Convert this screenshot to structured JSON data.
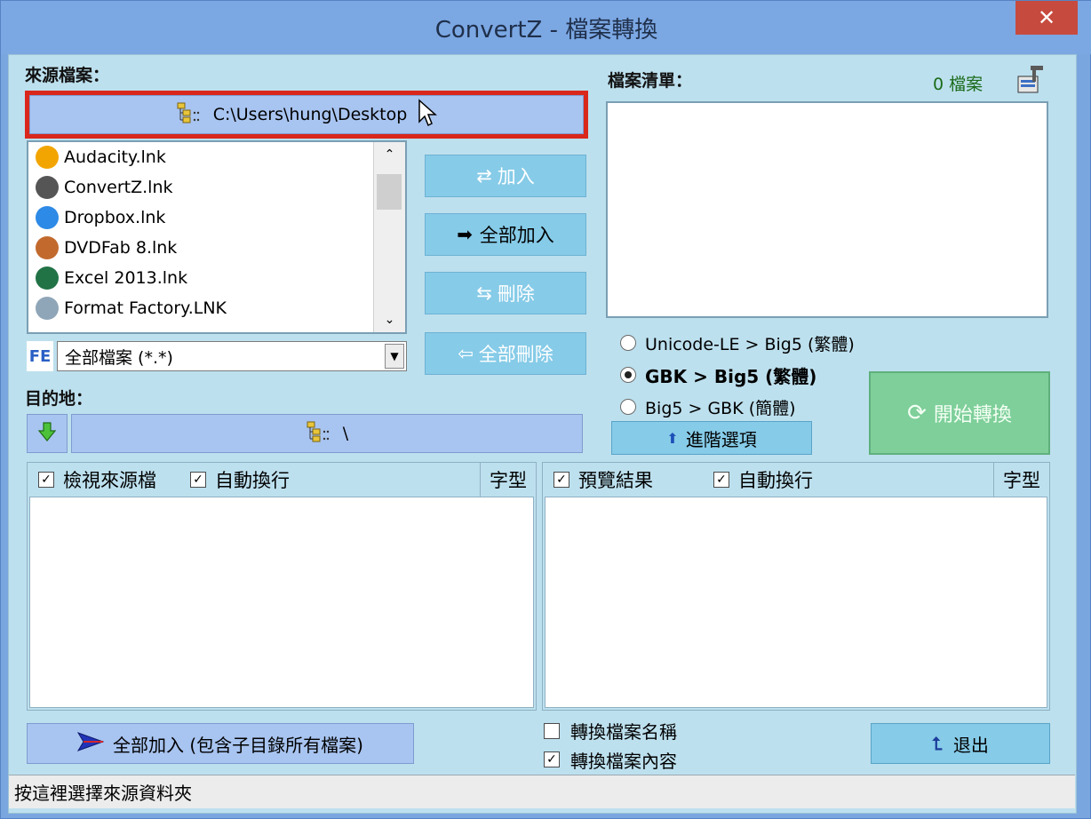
{
  "window": {
    "title": "ConvertZ - 檔案轉換",
    "close_label": "✕"
  },
  "source": {
    "label": "來源檔案：",
    "path": "C:\\Users\\hung\\Desktop",
    "files": [
      {
        "name": "Audacity.lnk",
        "icon": "audacity-icon",
        "color": "#f2a500"
      },
      {
        "name": "ConvertZ.lnk",
        "icon": "gear-icon",
        "color": "#555555"
      },
      {
        "name": "Dropbox.lnk",
        "icon": "dropbox-icon",
        "color": "#2d8ae6"
      },
      {
        "name": "DVDFab 8.lnk",
        "icon": "dvdfab-icon",
        "color": "#c26a2e"
      },
      {
        "name": "Excel 2013.lnk",
        "icon": "excel-icon",
        "color": "#217346"
      },
      {
        "name": "Format Factory.LNK",
        "icon": "format-factory-icon",
        "color": "#8fa6b8"
      }
    ],
    "filter_badge": "FE",
    "filter_value": "全部檔案 (*.*)"
  },
  "destination": {
    "label": "目的地：",
    "path": "\\"
  },
  "buttons": {
    "add": "加入",
    "add_all": "全部加入",
    "delete": "刪除",
    "delete_all": "全部刪除",
    "start": "開始轉換",
    "advanced": "進階選項",
    "add_all_recursive": "全部加入 (包含子目錄所有檔案)",
    "exit": "退出"
  },
  "file_list": {
    "label": "檔案清單：",
    "count": "0 檔案"
  },
  "conversion_modes": [
    {
      "label": "Unicode-LE > Big5 (繁體)",
      "selected": false
    },
    {
      "label": "GBK > Big5 (繁體)",
      "selected": true
    },
    {
      "label": "Big5 > GBK (簡體)",
      "selected": false
    }
  ],
  "source_pane": {
    "view_source": "檢視來源檔",
    "word_wrap": "自動換行",
    "font": "字型"
  },
  "preview_pane": {
    "preview_result": "預覽結果",
    "word_wrap": "自動換行",
    "font": "字型"
  },
  "options": {
    "convert_filename": "轉換檔案名稱",
    "convert_content": "轉換檔案內容"
  },
  "status_text": "按這裡選擇來源資料夾",
  "check_mark": "✓"
}
